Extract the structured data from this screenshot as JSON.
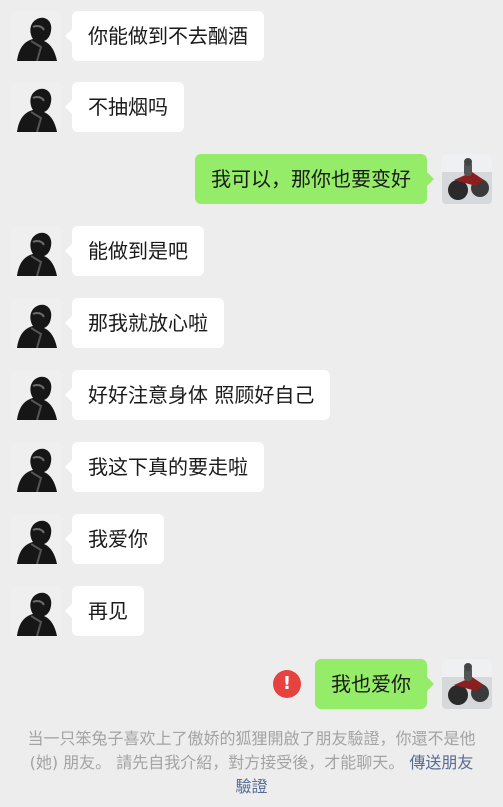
{
  "messages": [
    {
      "side": "left",
      "text": "你能做到不去酗酒"
    },
    {
      "side": "left",
      "text": "不抽烟吗"
    },
    {
      "side": "right",
      "text": "我可以，那你也要变好"
    },
    {
      "side": "left",
      "text": "能做到是吧"
    },
    {
      "side": "left",
      "text": "那我就放心啦"
    },
    {
      "side": "left",
      "text": "好好注意身体 照顾好自己"
    },
    {
      "side": "left",
      "text": "我这下真的要走啦"
    },
    {
      "side": "left",
      "text": "我爱你"
    },
    {
      "side": "left",
      "text": "再见"
    },
    {
      "side": "right",
      "text": "我也爱你",
      "failed": true
    }
  ],
  "failed_icon": {
    "name": "exclamation-icon",
    "glyph": "!"
  },
  "notice": {
    "text": "当一只笨兔子喜欢上了傲娇的狐狸開啟了朋友驗證，你還不是他 (她) 朋友。 請先自我介紹，對方接受後，才能聊天。 ",
    "link": "傳送朋友驗證"
  },
  "colors": {
    "background": "#ededed",
    "incoming_bubble": "#ffffff",
    "outgoing_bubble": "#95ec69",
    "error": "#e64340",
    "link": "#576b95",
    "notice_text": "#a3a3a3"
  }
}
